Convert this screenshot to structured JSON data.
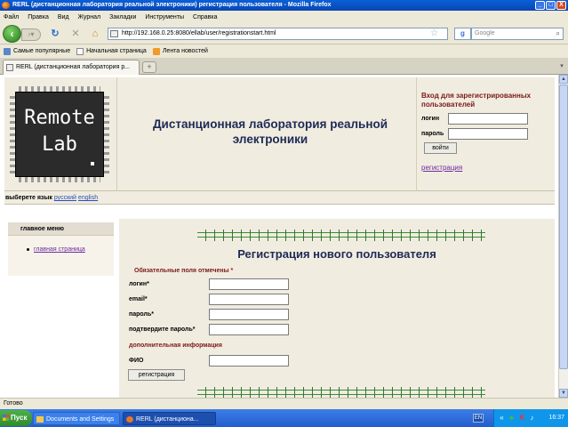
{
  "window": {
    "title": "RERL (дистанционная лаборатория реальной электроники) регистрация пользователя - Mozilla Firefox",
    "minimize": "_",
    "maximize": "□",
    "close": "X"
  },
  "menu": [
    "Файл",
    "Правка",
    "Вид",
    "Журнал",
    "Закладки",
    "Инструменты",
    "Справка"
  ],
  "nav": {
    "url": "http://192.168.0.25:8080/ellab/user/registrationstart.html",
    "search_placeholder": "Google",
    "search_engine": "g"
  },
  "bookmarks": [
    "Самые популярные",
    "Начальная страница",
    "Лента новостей"
  ],
  "tab": {
    "title": "RERL (дистанционная лаборатория р..."
  },
  "header": {
    "logo_line1": "Remote",
    "logo_line2": "Lab",
    "site_title": "Дистанционная лаборатория реальной электроники"
  },
  "login": {
    "title": "Вход для зарегистрированных пользователей",
    "login_label": "логин",
    "password_label": "пароль",
    "submit": "войти",
    "register_link": "регистрация"
  },
  "language": {
    "label": "выберете язык",
    "options": [
      "русский",
      "english"
    ]
  },
  "sidebar": {
    "heading": "главное меню",
    "items": [
      {
        "label": "главная страница"
      }
    ]
  },
  "form": {
    "title": "Регистрация нового пользователя",
    "required_note": "Обязательные поля отмечены",
    "required_marker": "*",
    "fields": [
      {
        "label": "логин*",
        "value": ""
      },
      {
        "label": "email*",
        "value": ""
      },
      {
        "label": "пароль*",
        "value": ""
      },
      {
        "label": "подтвердите пароль*",
        "value": ""
      }
    ],
    "extra_heading": "дополнительная информация",
    "extra_fields": [
      {
        "label": "ФИО",
        "value": ""
      }
    ],
    "submit": "регистрация"
  },
  "status": {
    "text": "Готово"
  },
  "taskbar": {
    "start": "Пуск",
    "tasks": [
      "Documents and Settings",
      "RERL (дистанциона..."
    ],
    "lang": "EN",
    "clock": "16:37"
  },
  "colors": {
    "title_blue": "#1c2a55",
    "accent_red": "#7a1a1a",
    "link_purple": "#6b2aa0",
    "panel_bg": "#f1ece0"
  }
}
